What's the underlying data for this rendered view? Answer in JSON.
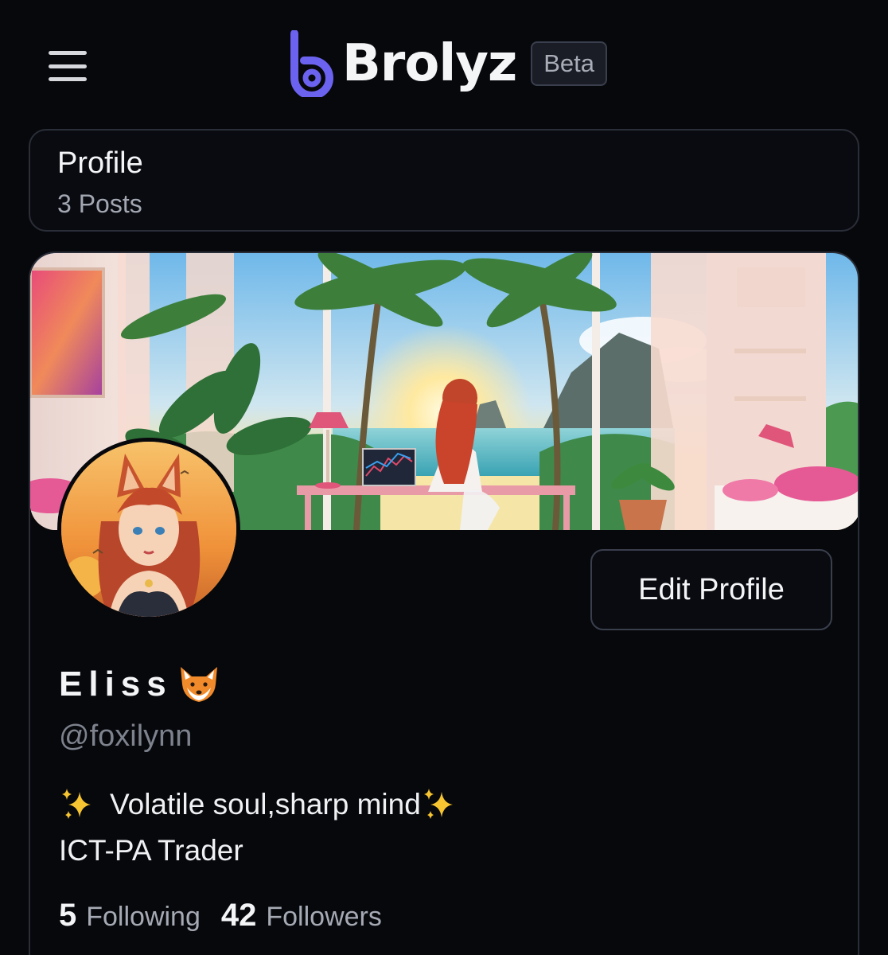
{
  "header": {
    "menu_icon": "hamburger-menu-icon",
    "brand_name": "Brolyz",
    "beta_label": "Beta",
    "brand_color": "#6b63f0"
  },
  "profile_header": {
    "title": "Profile",
    "posts": "3 Posts"
  },
  "profile": {
    "display_name": "Eliss",
    "name_emoji_icon": "fox-face-icon",
    "handle": "@foxilynn",
    "bio_line1": "Volatile soul,sharp mind",
    "bio_line2": "ICT-PA Trader",
    "sparkle_icon": "sparkles-icon",
    "edit_button": "Edit Profile",
    "following_count": "5",
    "following_label": "Following",
    "followers_count": "42",
    "followers_label": "Followers"
  }
}
